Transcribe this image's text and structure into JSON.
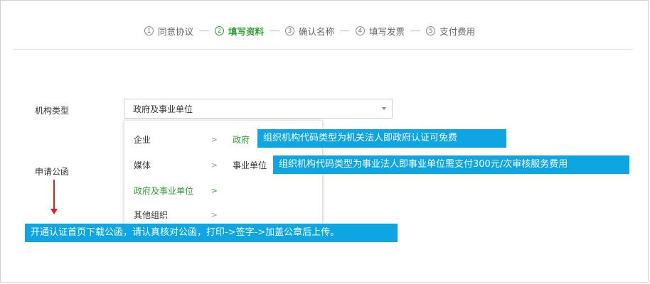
{
  "steps": [
    {
      "num": "1",
      "label": "同意协议"
    },
    {
      "num": "2",
      "label": "填写资料"
    },
    {
      "num": "3",
      "label": "确认名称"
    },
    {
      "num": "4",
      "label": "填写发票"
    },
    {
      "num": "5",
      "label": "支付费用"
    }
  ],
  "active_step": 2,
  "form": {
    "org_type_label": "机构类型",
    "org_type_value": "政府及事业单位",
    "letter_label": "申请公函"
  },
  "dropdown": {
    "level1": [
      {
        "label": "企业",
        "chevron": ">"
      },
      {
        "label": "媒体",
        "chevron": ">"
      },
      {
        "label": "政府及事业单位",
        "chevron": ">"
      },
      {
        "label": "其他组织",
        "chevron": ">"
      }
    ],
    "level2": [
      {
        "label": "政府"
      },
      {
        "label": "事业单位"
      }
    ]
  },
  "callouts": {
    "government": "组织机构代码类型为机关法人即政府认证可免费",
    "institution": "组织机构代码类型为事业法人即事业单位需支付300元/次审核服务费用",
    "letter": "开通认证首页下载公函，请认真核对公函，打印->签字->加盖公章后上传。"
  },
  "colors": {
    "active_green": "#2f9e2f",
    "callout_blue": "#0ea5e3",
    "arrow_red": "#e0201c"
  }
}
